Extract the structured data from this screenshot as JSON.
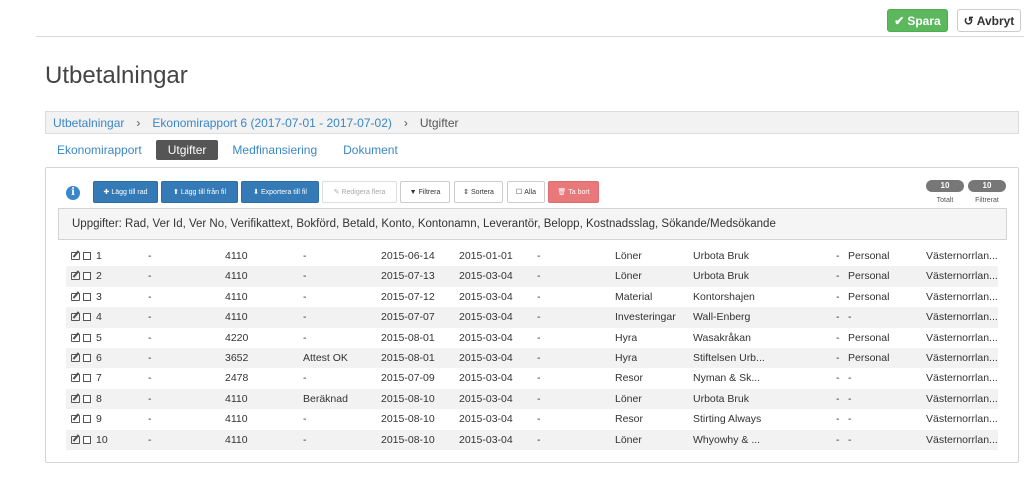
{
  "header": {
    "save_label": "Spara",
    "cancel_label": "Avbryt"
  },
  "page_title": "Utbetalningar",
  "breadcrumb": {
    "root": "Utbetalningar",
    "report": "Ekonomirapport 6 (2017-07-01 - 2017-07-02)",
    "current": "Utgifter",
    "separator": "›"
  },
  "tabs": [
    {
      "label": "Ekonomirapport",
      "active": false
    },
    {
      "label": "Utgifter",
      "active": true
    },
    {
      "label": "Medfinansiering",
      "active": false
    },
    {
      "label": "Dokument",
      "active": false
    }
  ],
  "toolbar": {
    "add_row": "Lägg till rad",
    "add_from_file": "Lägg till från fil",
    "export_to_file": "Exportera till fil",
    "edit_multiple": "Redigera flera",
    "filter": "Filtrera",
    "sort": "Sortera",
    "all": "Alla",
    "delete": "Ta bort"
  },
  "counters": {
    "total_value": "10",
    "total_label": "Totalt",
    "filtered_value": "10",
    "filtered_label": "Filtrerat"
  },
  "fields_description": "Uppgifter: Rad, Ver Id, Ver No, Verifikattext, Bokförd, Betald, Konto, Kontonamn, Leverantör, Belopp, Kostnadsslag, Sökande/Medsökande",
  "rows": [
    {
      "rad": "1",
      "ver_id": "-",
      "ver_no": "4110",
      "text": "-",
      "bokford": "2015-06-14",
      "betald": "2015-01-01",
      "konto": "-",
      "kontonamn": "Löner",
      "leverantor": "Urbota Bruk",
      "belopp": "-",
      "kostnadsslag": "Personal",
      "sokande": "Västernorrlan..."
    },
    {
      "rad": "2",
      "ver_id": "-",
      "ver_no": "4110",
      "text": "-",
      "bokford": "2015-07-13",
      "betald": "2015-03-04",
      "konto": "-",
      "kontonamn": "Löner",
      "leverantor": "Urbota Bruk",
      "belopp": "-",
      "kostnadsslag": "Personal",
      "sokande": "Västernorrlan..."
    },
    {
      "rad": "3",
      "ver_id": "-",
      "ver_no": "4110",
      "text": "-",
      "bokford": "2015-07-12",
      "betald": "2015-03-04",
      "konto": "-",
      "kontonamn": "Material",
      "leverantor": "Kontorshajen",
      "belopp": "-",
      "kostnadsslag": "Personal",
      "sokande": "Västernorrlan..."
    },
    {
      "rad": "4",
      "ver_id": "-",
      "ver_no": "4110",
      "text": "-",
      "bokford": "2015-07-07",
      "betald": "2015-03-04",
      "konto": "-",
      "kontonamn": "Investeringar",
      "leverantor": "Wall-Enberg",
      "belopp": "-",
      "kostnadsslag": "-",
      "sokande": "Västernorrlan..."
    },
    {
      "rad": "5",
      "ver_id": "-",
      "ver_no": "4220",
      "text": "-",
      "bokford": "2015-08-01",
      "betald": "2015-03-04",
      "konto": "-",
      "kontonamn": "Hyra",
      "leverantor": "Wasakråkan",
      "belopp": "-",
      "kostnadsslag": "Personal",
      "sokande": "Västernorrlan..."
    },
    {
      "rad": "6",
      "ver_id": "-",
      "ver_no": "3652",
      "text": "Attest OK",
      "bokford": "2015-08-01",
      "betald": "2015-03-04",
      "konto": "-",
      "kontonamn": "Hyra",
      "leverantor": "Stiftelsen Urb...",
      "belopp": "-",
      "kostnadsslag": "Personal",
      "sokande": "Västernorrlan..."
    },
    {
      "rad": "7",
      "ver_id": "-",
      "ver_no": "2478",
      "text": "-",
      "bokford": "2015-07-09",
      "betald": "2015-03-04",
      "konto": "-",
      "kontonamn": "Resor",
      "leverantor": "Nyman & Sk...",
      "belopp": "-",
      "kostnadsslag": "-",
      "sokande": "Västernorrlan..."
    },
    {
      "rad": "8",
      "ver_id": "-",
      "ver_no": "4110",
      "text": "Beräknad",
      "bokford": "2015-08-10",
      "betald": "2015-03-04",
      "konto": "-",
      "kontonamn": "Löner",
      "leverantor": "Urbota Bruk",
      "belopp": "-",
      "kostnadsslag": "-",
      "sokande": "Västernorrlan..."
    },
    {
      "rad": "9",
      "ver_id": "-",
      "ver_no": "4110",
      "text": "-",
      "bokford": "2015-08-10",
      "betald": "2015-03-04",
      "konto": "-",
      "kontonamn": "Resor",
      "leverantor": "Stirting Always",
      "belopp": "-",
      "kostnadsslag": "-",
      "sokande": "Västernorrlan..."
    },
    {
      "rad": "10",
      "ver_id": "-",
      "ver_no": "4110",
      "text": "-",
      "bokford": "2015-08-10",
      "betald": "2015-03-04",
      "konto": "-",
      "kontonamn": "Löner",
      "leverantor": "Whyowhy & ...",
      "belopp": "-",
      "kostnadsslag": "-",
      "sokande": "Västernorrlan..."
    }
  ],
  "colors": {
    "save": "#5cb85c",
    "primary": "#337ab7",
    "danger": "#e8787a",
    "link": "#3a87c8"
  }
}
